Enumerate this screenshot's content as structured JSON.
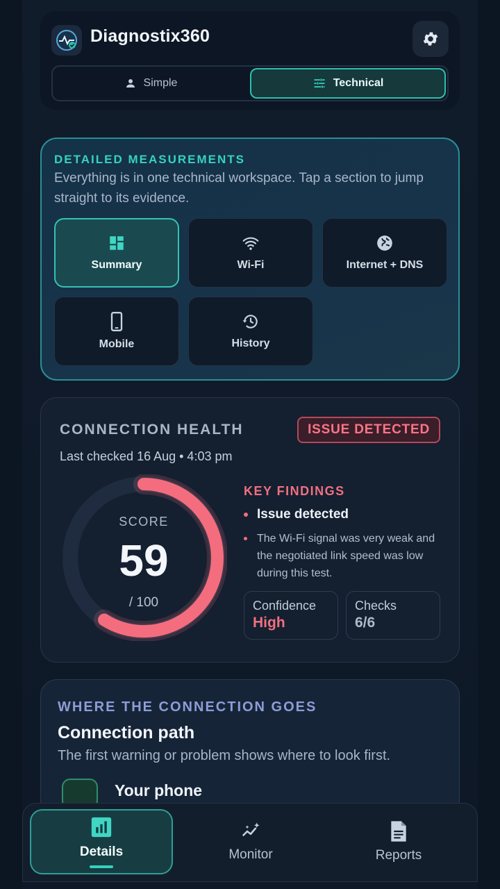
{
  "app": {
    "title": "Diagnostix360"
  },
  "mode_toggle": {
    "simple_label": "Simple",
    "technical_label": "Technical",
    "selected": "Technical"
  },
  "measurements": {
    "kicker": "DETAILED MEASUREMENTS",
    "description": "Everything is in one technical workspace. Tap a section to jump straight to its evidence.",
    "tiles": [
      {
        "label": "Summary",
        "icon": "dashboard-icon",
        "active": true
      },
      {
        "label": "Wi-Fi",
        "icon": "wifi-icon",
        "active": false
      },
      {
        "label": "Internet + DNS",
        "icon": "globe-icon",
        "active": false
      },
      {
        "label": "Mobile",
        "icon": "phone-icon",
        "active": false
      },
      {
        "label": "History",
        "icon": "history-icon",
        "active": false
      }
    ]
  },
  "health": {
    "title": "CONNECTION HEALTH",
    "badge": "ISSUE DETECTED",
    "last_checked": "Last checked 16 Aug • 4:03 pm",
    "score_label": "SCORE",
    "score": "59",
    "score_max": "/ 100",
    "score_fraction": 0.59,
    "findings_title": "KEY FINDINGS",
    "finding_main": "Issue detected",
    "finding_detail": "The Wi-Fi signal was very weak and the negotiated link speed was low during this test.",
    "confidence_label": "Confidence",
    "confidence_value": "High",
    "checks_label": "Checks",
    "checks_value": "6/6"
  },
  "path": {
    "kicker": "WHERE THE CONNECTION GOES",
    "title": "Connection path",
    "description": "The first warning or problem shows where to look first.",
    "first_step": "Your phone"
  },
  "nav": {
    "details": "Details",
    "monitor": "Monitor",
    "reports": "Reports"
  },
  "colors": {
    "accent": "#35d0bf",
    "issue": "#f0707f",
    "gauge_track": "#1f2c3f"
  }
}
